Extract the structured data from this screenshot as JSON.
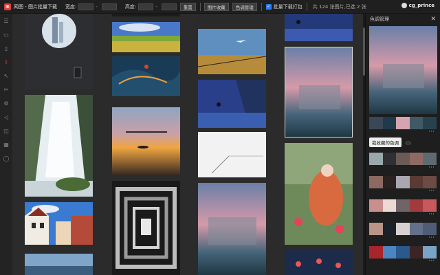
{
  "app": {
    "title": "网图 - 图片批量下载",
    "logo_icon": "app-logo-icon"
  },
  "toolbar": {
    "width_label": "宽度:",
    "height_label": "高度:",
    "dash": "-",
    "reset_label": "重置",
    "collect_label": "图片收藏",
    "color_label": "色调管理",
    "batch_label": "批量下载打包",
    "stats": "共 124 张图片,已选 2 张"
  },
  "user": {
    "name": "cg_prince"
  },
  "rail": [
    "menu-icon",
    "image-icon",
    "note-icon",
    "download-icon",
    "cursor-icon",
    "pin-icon",
    "gear-icon",
    "megaphone-icon",
    "bag-icon",
    "calendar-icon",
    "chat-icon"
  ],
  "panel": {
    "title": "色调管理",
    "close": "✕",
    "more": "···",
    "fav_label": "我收藏的色调",
    "main_swatches": [
      "#3a4756",
      "#1f3a4a",
      "#d6a3b0",
      "#3f5a66",
      "#27424e"
    ],
    "palettes": [
      [
        "#9aa7ad",
        "#2f2f34",
        "#6b5a56",
        "#8d6b63",
        "#5d6b71"
      ],
      [
        "#8c6a62",
        "#2b2222",
        "#a9a8b1",
        "#5a3a34",
        "#6b4b44"
      ],
      [
        "#c98f8d",
        "#eedad4",
        "#6f6468",
        "#a33a3d",
        "#c7585b"
      ],
      [
        "#b99487",
        "#1b2129",
        "#d7d2cf",
        "#63708a",
        "#4f5c73"
      ],
      [
        "#a8262b",
        "#4c86c0",
        "#2a5a8c",
        "#3b2525",
        "#7aa4c7"
      ]
    ]
  }
}
